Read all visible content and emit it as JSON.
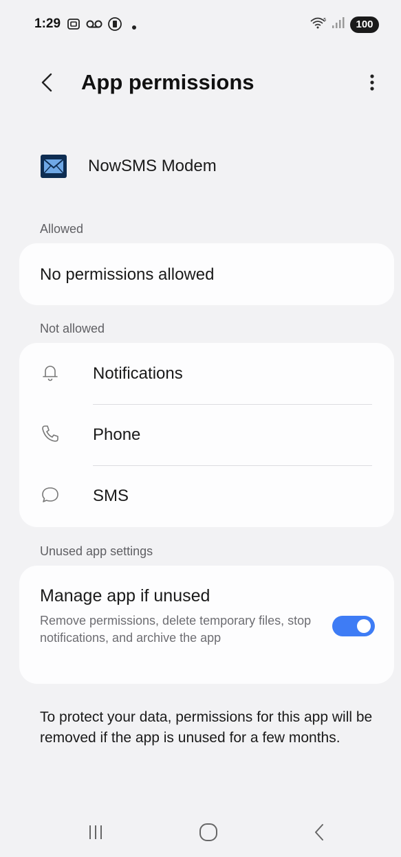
{
  "status_bar": {
    "time": "1:29",
    "battery": "100",
    "left_icons": [
      "screenshot-icon",
      "voicemail-icon",
      "media-icon"
    ],
    "right_icons": [
      "wifi-icon",
      "signal-icon"
    ]
  },
  "header": {
    "title": "App permissions",
    "back_icon": "back-icon",
    "more_icon": "more-options-icon"
  },
  "app": {
    "name": "NowSMS Modem",
    "icon": "mail-envelope-icon"
  },
  "allowed": {
    "label": "Allowed",
    "empty_text": "No permissions allowed"
  },
  "not_allowed": {
    "label": "Not allowed",
    "items": [
      {
        "label": "Notifications",
        "icon": "bell-icon"
      },
      {
        "label": "Phone",
        "icon": "phone-icon"
      },
      {
        "label": "SMS",
        "icon": "chat-bubble-icon"
      }
    ]
  },
  "unused": {
    "label": "Unused app settings",
    "manage_title": "Manage app if unused",
    "manage_desc": "Remove permissions, delete temporary files, stop notifications, and archive the app",
    "toggle_on": true
  },
  "footer_note": "To protect your data, permissions for this app will be removed if the app is unused for a few months.",
  "nav_bar": {
    "icons": [
      "recents-icon",
      "home-icon",
      "back-nav-icon"
    ]
  },
  "colors": {
    "background": "#f2f2f4",
    "card": "#fdfdfe",
    "accent": "#3e7cf5",
    "secondary_text": "#6d6d72"
  }
}
